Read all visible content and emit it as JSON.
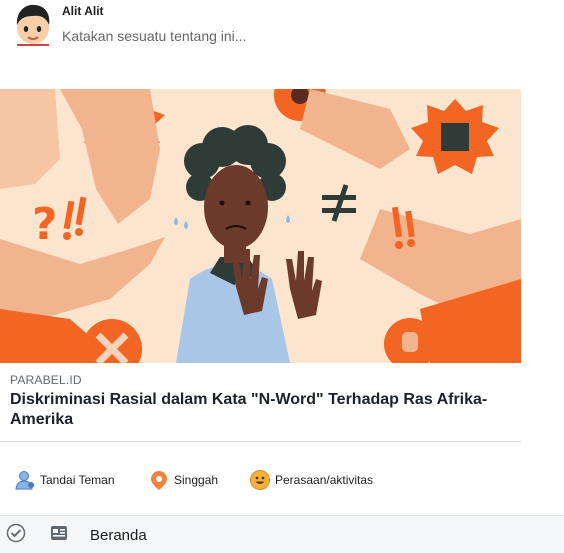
{
  "composer": {
    "user_name": "Alit Alit",
    "placeholder": "Katakan sesuatu tentang ini..."
  },
  "link_preview": {
    "image_icon": "illustration-racial-discrimination",
    "domain": "PARABEL.ID",
    "title": "Diskriminasi Rasial dalam Kata \"N-Word\" Terhadap Ras Afrika-Amerika"
  },
  "actions": [
    {
      "label": "Tandai Teman",
      "icon": "tag-friend-icon"
    },
    {
      "label": "Singgah",
      "icon": "location-pin-icon"
    },
    {
      "label": "Perasaan/aktivitas",
      "icon": "smiley-icon"
    }
  ],
  "bottom_bar": {
    "label": "Beranda",
    "icons": [
      "privacy-icon",
      "newsfeed-icon"
    ]
  },
  "colors": {
    "accent_orange": "#f26522",
    "peach_bg": "#fbe5cf",
    "skin_light": "#f2b48f",
    "skin_dark": "#6b3a2a",
    "shirt_blue": "#a8c6e6"
  }
}
